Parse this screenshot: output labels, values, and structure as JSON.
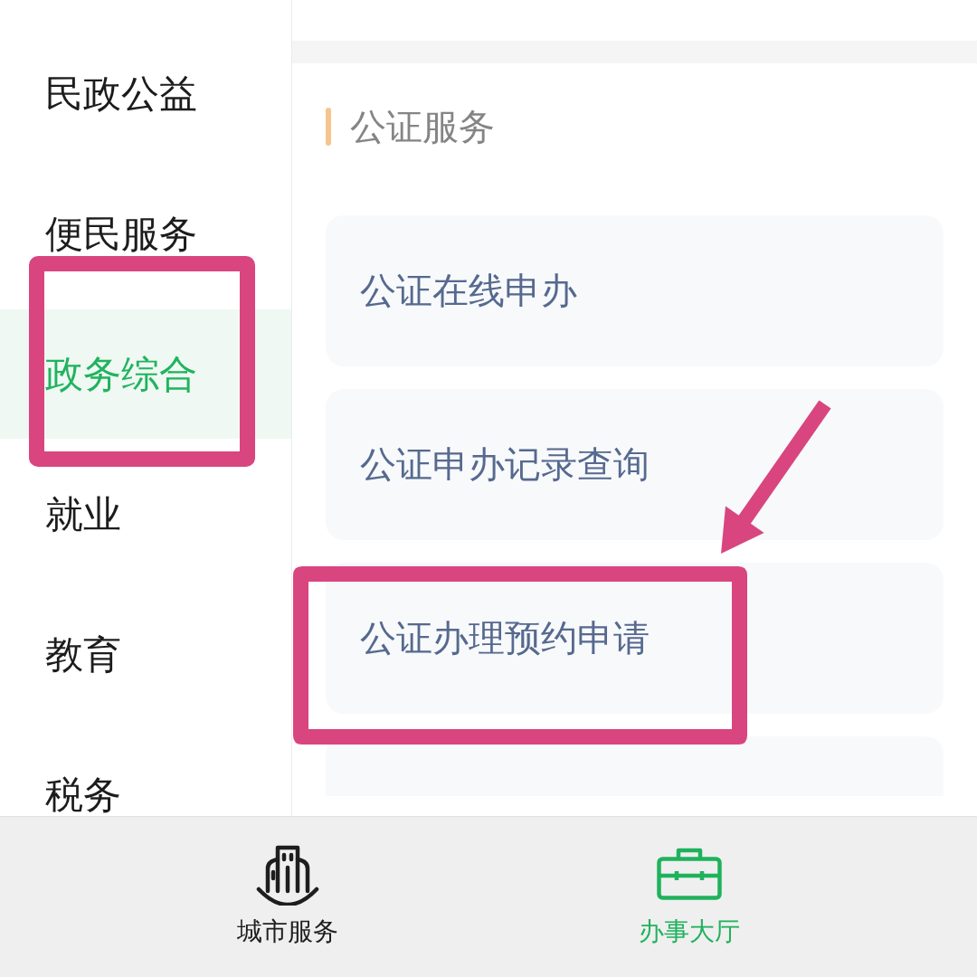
{
  "sidebar": {
    "items": [
      {
        "label": "民政公益",
        "selected": false,
        "highlighted": false
      },
      {
        "label": "便民服务",
        "selected": false,
        "highlighted": false
      },
      {
        "label": "政务综合",
        "selected": true,
        "highlighted": true
      },
      {
        "label": "就业",
        "selected": false,
        "highlighted": false
      },
      {
        "label": "教育",
        "selected": false,
        "highlighted": false
      },
      {
        "label": "税务",
        "selected": false,
        "highlighted": false
      }
    ]
  },
  "content": {
    "section": {
      "title": "公证服务",
      "items": [
        {
          "label": "公证在线申办",
          "highlighted": false,
          "pointed_at": false
        },
        {
          "label": "公证申办记录查询",
          "highlighted": false,
          "pointed_at": false
        },
        {
          "label": "公证办理预约申请",
          "highlighted": true,
          "pointed_at": true
        }
      ],
      "more_below": true
    }
  },
  "tab_bar": {
    "tabs": [
      {
        "label": "城市服务",
        "selected": false
      },
      {
        "label": "办事大厅",
        "selected": true
      }
    ]
  }
}
